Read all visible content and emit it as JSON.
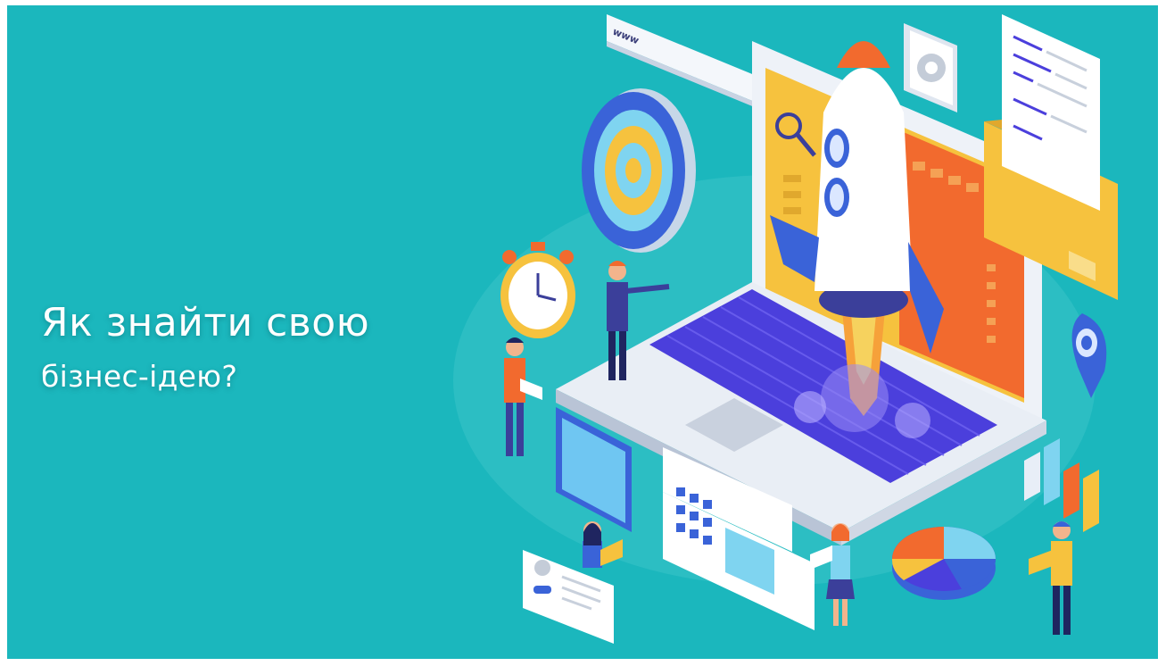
{
  "headline": {
    "line1": "Як знайти свою",
    "line2": "бізнес-ідею?"
  },
  "illustration": {
    "browser_bar_text": "www",
    "icons": [
      "target-icon",
      "stopwatch-icon",
      "rocket-icon",
      "laptop-icon",
      "gear-icon",
      "document-icon",
      "folder-icon",
      "calendar-icon",
      "pie-chart-icon",
      "bar-chart-icon",
      "location-pin-icon",
      "magnifier-icon"
    ]
  },
  "colors": {
    "background": "#1bb7bd",
    "text": "#ffffff",
    "accent_orange": "#f26a2e",
    "accent_yellow": "#f6c23e",
    "accent_purple": "#4b3fdc",
    "accent_blue": "#3a63d8"
  }
}
